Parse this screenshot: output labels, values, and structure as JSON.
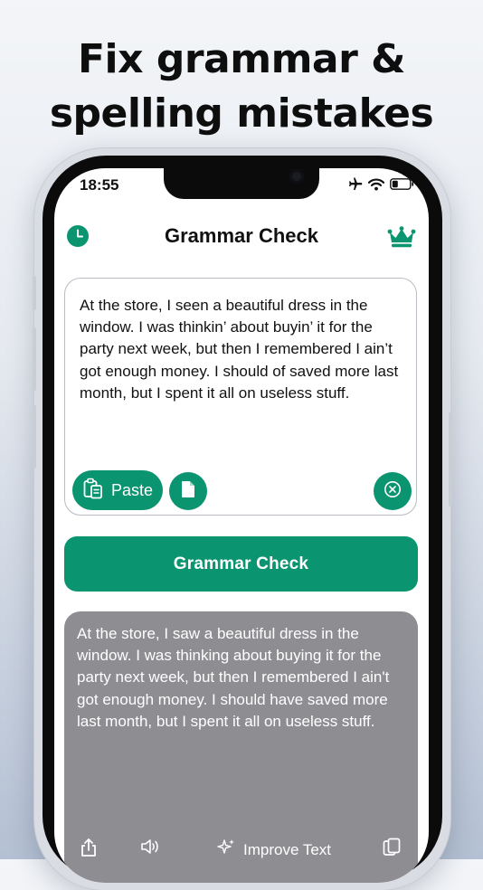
{
  "headline": {
    "line1": "Fix grammar &",
    "line2": "spelling mistakes"
  },
  "status_bar": {
    "time": "18:55",
    "icons": [
      "airplane-icon",
      "wifi-icon",
      "battery-icon"
    ]
  },
  "nav": {
    "title": "Grammar Check",
    "left_icon": "history-clock-icon",
    "right_icon": "crown-icon"
  },
  "input": {
    "text": "At the store, I seen a beautiful dress in the window. I was thinkin’ about buyin’ it for the party next week, but then I remembered I ain’t got enough money. I should of saved more last month, but I spent it all on useless stuff.",
    "paste_label": "Paste",
    "icons": [
      "paste-icon",
      "document-icon",
      "clear-icon"
    ]
  },
  "action": {
    "label": "Grammar Check"
  },
  "output": {
    "text": "At the store, I saw a beautiful dress in the window. I was thinking about buying it for the party next week, but then I remembered I ain't got enough money. I should have saved more last month, but I spent it all on useless stuff.",
    "improve_label": "Improve Text",
    "icons": [
      "share-icon",
      "speaker-icon",
      "sparkles-icon",
      "copy-icon"
    ]
  },
  "colors": {
    "accent": "#0a9470",
    "output_bg": "#8e8d92"
  }
}
